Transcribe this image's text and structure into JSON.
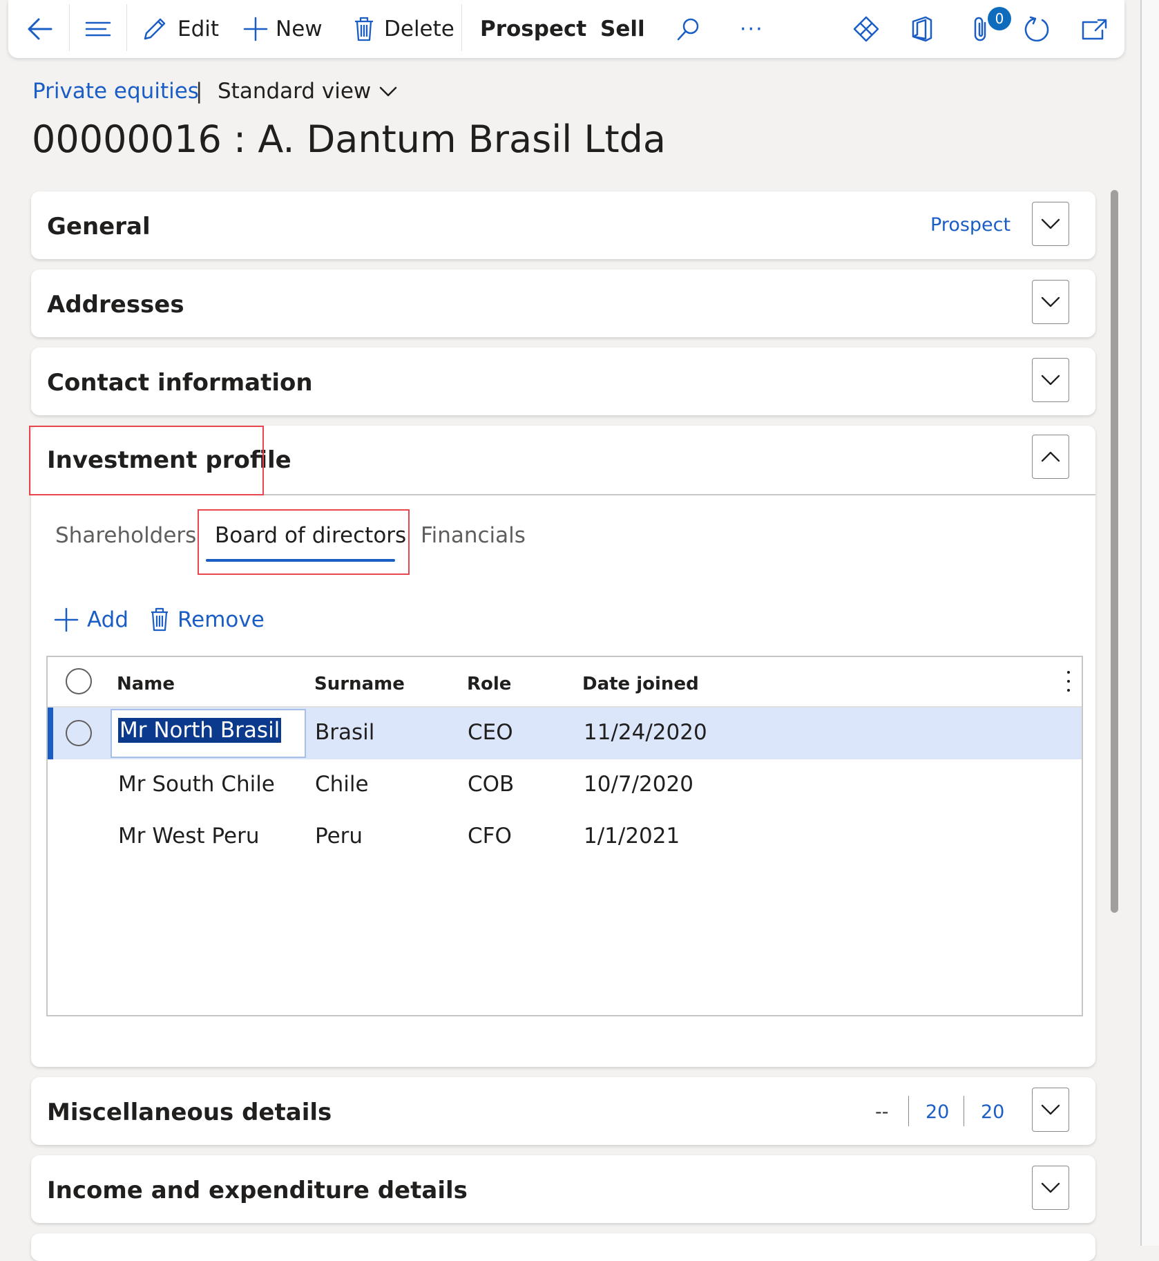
{
  "toolbar": {
    "back_icon": "arrow-left-icon",
    "menu_icon": "hamburger-icon",
    "edit_label": "Edit",
    "new_label": "New",
    "delete_label": "Delete",
    "prospect_label": "Prospect",
    "sell_label": "Sell",
    "more_label": "···",
    "attachments_count": "0"
  },
  "breadcrumb": {
    "link": "Private equities",
    "separator": "|",
    "view": "Standard view"
  },
  "page_title": "00000016 : A. Dantum Brasil Ltda",
  "sections": {
    "general": {
      "title": "General",
      "summary": "Prospect"
    },
    "addresses": {
      "title": "Addresses"
    },
    "contact": {
      "title": "Contact information"
    },
    "investment": {
      "title": "Investment profile",
      "tabs": [
        "Shareholders",
        "Board of directors",
        "Financials"
      ],
      "active_tab": "Board of directors",
      "actions": {
        "add": "Add",
        "remove": "Remove"
      },
      "grid": {
        "columns": [
          "Name",
          "Surname",
          "Role",
          "Date joined"
        ],
        "rows": [
          {
            "name": "Mr North Brasil",
            "surname": "Brasil",
            "role": "CEO",
            "date_joined": "11/24/2020"
          },
          {
            "name": "Mr South Chile",
            "surname": "Chile",
            "role": "COB",
            "date_joined": "10/7/2020"
          },
          {
            "name": "Mr West Peru",
            "surname": "Peru",
            "role": "CFO",
            "date_joined": "1/1/2021"
          }
        ]
      }
    },
    "misc": {
      "title": "Miscellaneous details",
      "summary1": "--",
      "summary2": "20",
      "summary3": "20"
    },
    "income": {
      "title": "Income and expenditure details"
    }
  },
  "colors": {
    "accent": "#1a5ec5",
    "selection": "#dce6fb",
    "highlight_box": "#e8454f",
    "badge": "#0f6cbd"
  }
}
